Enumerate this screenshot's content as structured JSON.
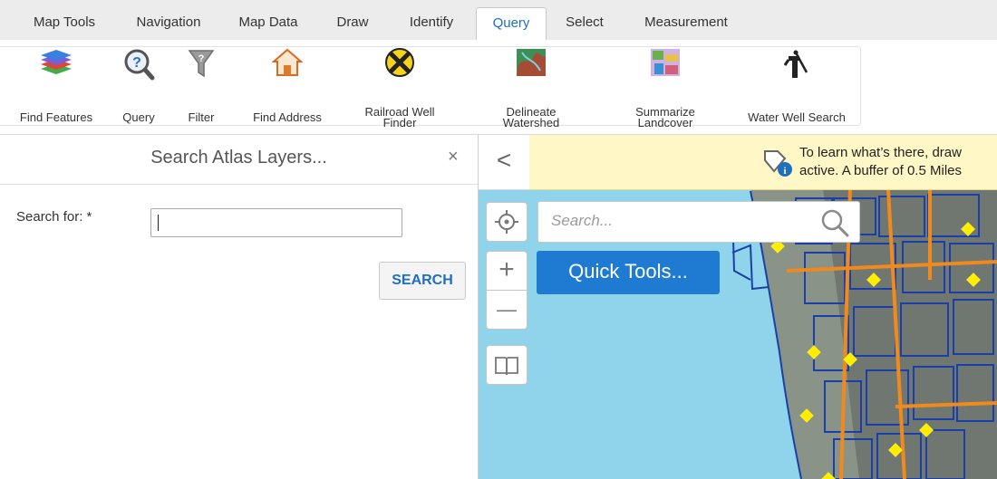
{
  "tabs": [
    {
      "label": "Map Tools",
      "active": false
    },
    {
      "label": "Navigation",
      "active": false
    },
    {
      "label": "Map Data",
      "active": false
    },
    {
      "label": "Draw",
      "active": false
    },
    {
      "label": "Identify",
      "active": false
    },
    {
      "label": "Query",
      "active": true
    },
    {
      "label": "Select",
      "active": false
    },
    {
      "label": "Measurement",
      "active": false
    }
  ],
  "ribbon": {
    "tools": [
      {
        "label": "Find Features",
        "icon": "layers-icon"
      },
      {
        "label": "Query",
        "icon": "magnifier-question-icon"
      },
      {
        "label": "Filter",
        "icon": "funnel-icon"
      },
      {
        "label": "Find Address",
        "icon": "house-icon"
      },
      {
        "label": "Railroad Well\nFinder",
        "icon": "railroad-crossing-icon"
      },
      {
        "label": "Delineate\nWatershed",
        "icon": "watershed-map-icon"
      },
      {
        "label": "Summarize\nLandcover",
        "icon": "landcover-map-icon"
      },
      {
        "label": "Water Well Search",
        "icon": "water-pump-icon"
      }
    ]
  },
  "left_panel": {
    "title": "Search Atlas Layers...",
    "close": "×",
    "search_label": "Search for: *",
    "search_value": "",
    "search_button": "SEARCH"
  },
  "map": {
    "collapse": "<",
    "banner_line1": "To learn what’s there, draw",
    "banner_line2": "active. A buffer of 0.5 Miles",
    "search_placeholder": "Search...",
    "quick_tools": "Quick Tools...",
    "zoom_in": "+",
    "zoom_out": "—",
    "colors": {
      "water": "#8fd4ea",
      "parcel_lines": "#1a3fa8",
      "roads": "#f08a1c",
      "points": "#ffee00"
    }
  }
}
